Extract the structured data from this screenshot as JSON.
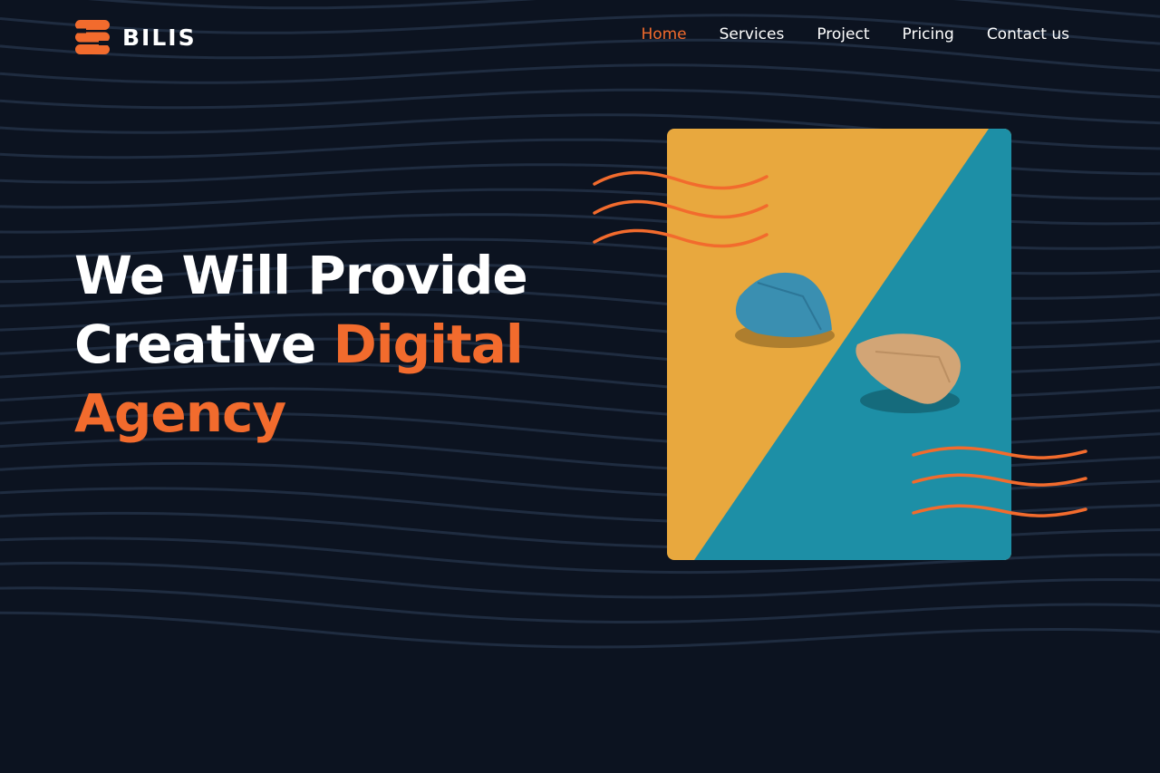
{
  "brand": {
    "name": "BILIS",
    "accent_color": "#f26b2d",
    "background_color": "#0c1320"
  },
  "nav": {
    "items": [
      {
        "label": "Home",
        "active": true
      },
      {
        "label": "Services",
        "active": false
      },
      {
        "label": "Project",
        "active": false
      },
      {
        "label": "Pricing",
        "active": false
      },
      {
        "label": "Contact us",
        "active": false
      }
    ]
  },
  "hero": {
    "line1": "We Will Provide",
    "line2_white": "Creative",
    "line2_accent": "Digital",
    "line3_accent": "Agency",
    "image": {
      "description_colors": {
        "yellow": "#e8a83e",
        "teal": "#1d8fa6"
      },
      "icon": "guitar-picks-photo"
    }
  }
}
